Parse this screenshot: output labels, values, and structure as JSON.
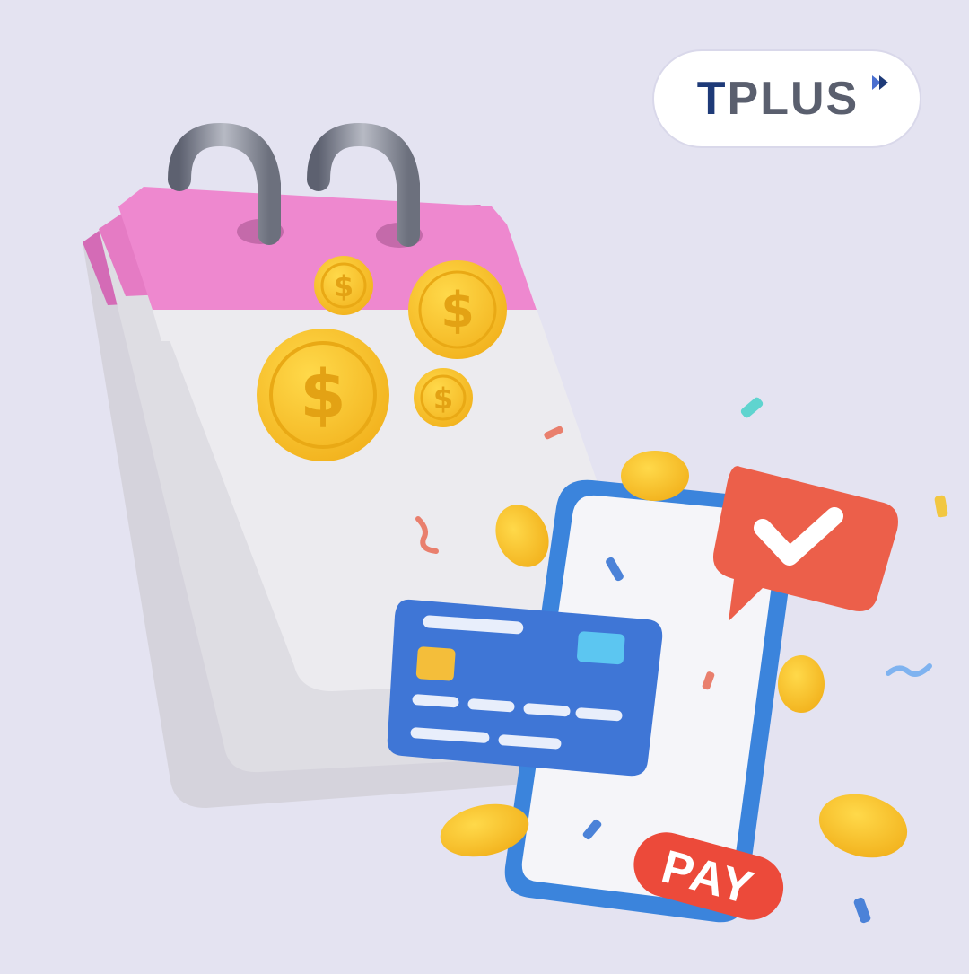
{
  "brand": {
    "logo_text_first": "T",
    "logo_text_rest": "PLUS",
    "logo_color": "#1e3a78",
    "logo_accent": "#4a6fd0"
  },
  "illustration": {
    "pay_button_label": "PAY",
    "calendar_header_color": "#ee88cf",
    "calendar_page_color": "#ecebef",
    "phone_frame_color": "#3b84dc",
    "card_color": "#3f76d6",
    "chat_bubble_color": "#ec5f4a",
    "coin_color": "#f7c332",
    "background_color": "#e4e3f1",
    "icons": [
      "calendar-icon",
      "coin-icon",
      "phone-icon",
      "credit-card-icon",
      "checkmark-chat-icon",
      "pay-button-icon"
    ]
  }
}
